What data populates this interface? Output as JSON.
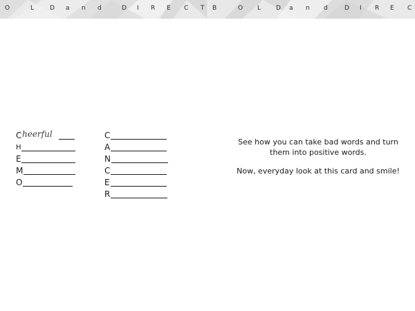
{
  "banner": {
    "left_letters": [
      "O",
      "L",
      "D",
      "a",
      "n",
      "d",
      "D",
      "I",
      "R",
      "E",
      "C",
      "T"
    ],
    "right_letters": [
      "B",
      "O",
      "L",
      "D",
      "a",
      "n",
      "d",
      "D",
      "I",
      "R",
      "E",
      "C"
    ]
  },
  "acrostic_1": {
    "lines": [
      {
        "letter": "C",
        "word": "heerful"
      },
      {
        "letter": "H",
        "word": ""
      },
      {
        "letter": "E",
        "word": ""
      },
      {
        "letter": "M",
        "word": ""
      },
      {
        "letter": "O",
        "word": ""
      }
    ]
  },
  "acrostic_2": {
    "lines": [
      {
        "letter": "C"
      },
      {
        "letter": "A"
      },
      {
        "letter": "N"
      },
      {
        "letter": "C"
      },
      {
        "letter": "E"
      },
      {
        "letter": "R"
      }
    ]
  },
  "message": {
    "line1": "See how you can take bad words and turn them into positive words.",
    "line2": "Now, everyday look at this card and smile!"
  }
}
